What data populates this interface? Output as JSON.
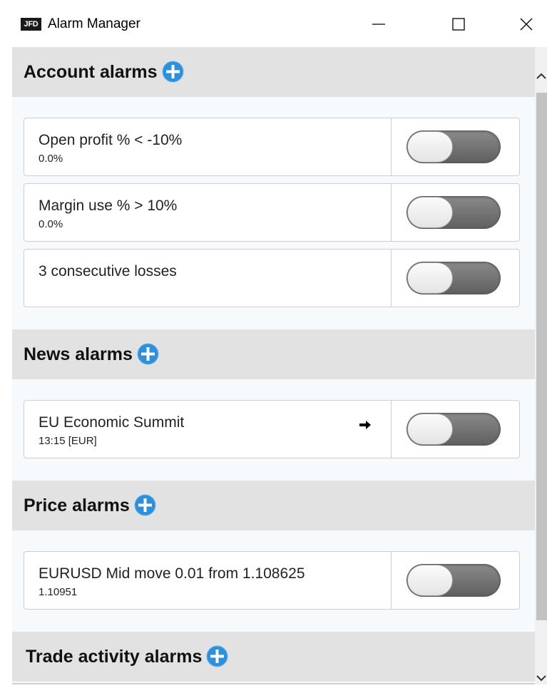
{
  "window": {
    "logo_text": "JFD",
    "title": "Alarm Manager"
  },
  "sections": [
    {
      "title": "Account alarms",
      "alarms": [
        {
          "title": "Open profit % < -10%",
          "value": "0.0%",
          "enabled": false
        },
        {
          "title": "Margin use % > 10%",
          "value": "0.0%",
          "enabled": false
        },
        {
          "title": "3 consecutive losses",
          "value": "",
          "enabled": false
        }
      ]
    },
    {
      "title": "News alarms",
      "alarms": [
        {
          "title": "EU Economic Summit",
          "value": "13:15 [EUR]",
          "enabled": false,
          "icon": "arrow-right-icon"
        }
      ]
    },
    {
      "title": "Price alarms",
      "alarms": [
        {
          "title": "EURUSD Mid move 0.01 from 1.108625",
          "value": "1.10951",
          "enabled": false
        }
      ]
    },
    {
      "title": "Trade activity alarms",
      "alarms": []
    }
  ],
  "colors": {
    "add_icon": "#2f8fd8",
    "section_header_bg": "#e2e2e2",
    "content_bg": "#f7fafd"
  }
}
